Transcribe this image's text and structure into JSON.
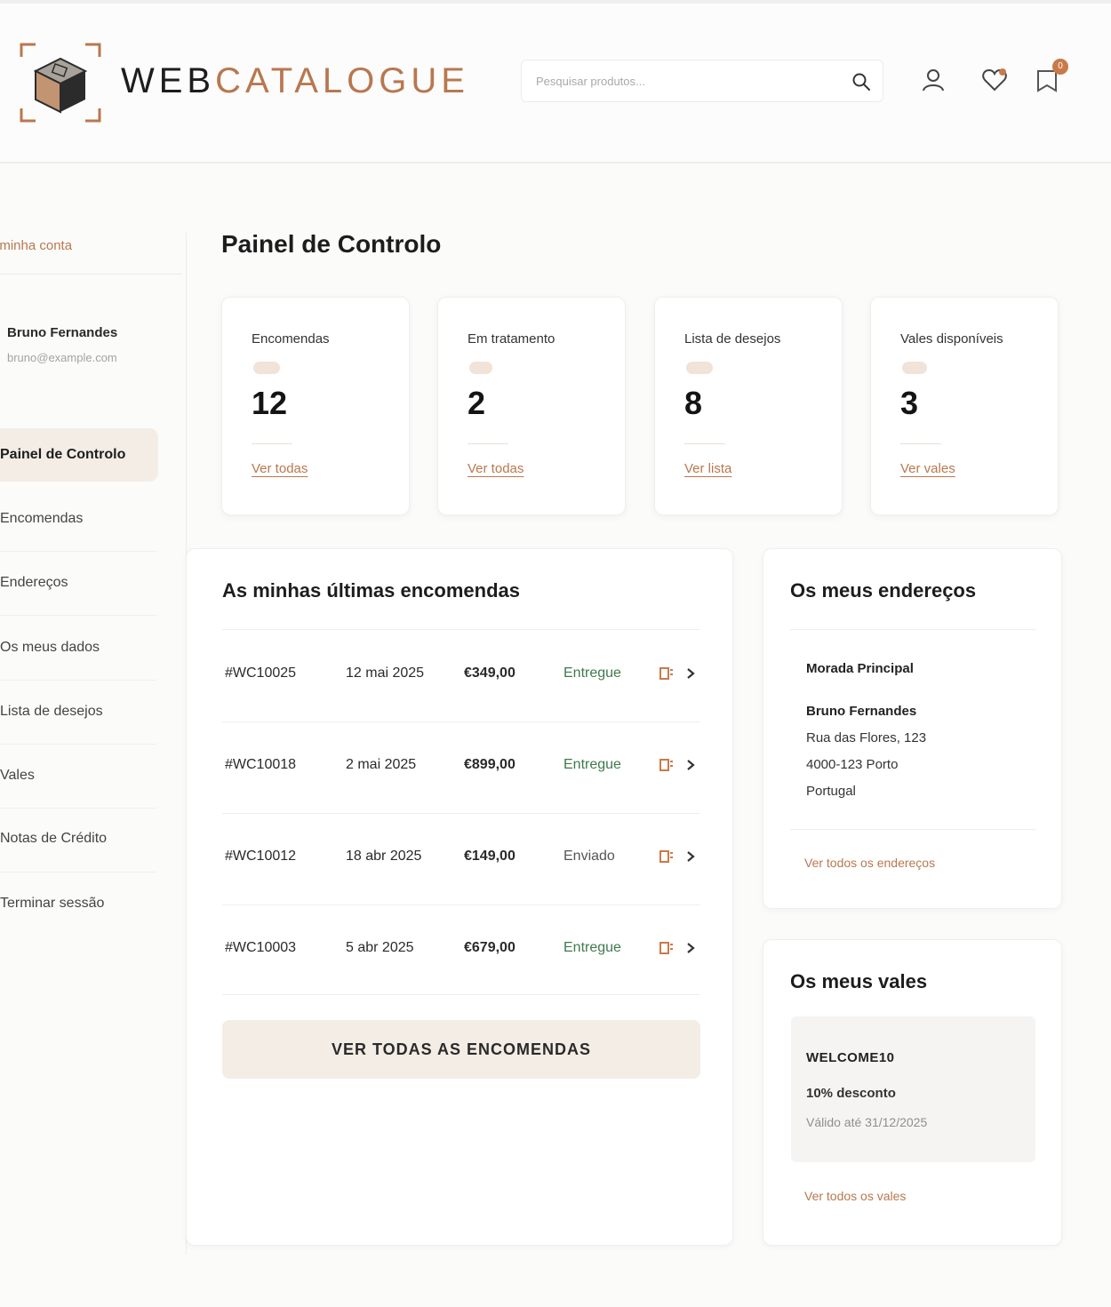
{
  "brand": {
    "part1": "WEB",
    "part2": "CATALOGUE",
    "accent": "#b8784f"
  },
  "search": {
    "placeholder": "Pesquisar produtos..."
  },
  "header_icons": [
    "user-icon",
    "heart-icon",
    "cart-icon"
  ],
  "cart": {
    "count": "0"
  },
  "sidebar": {
    "title": "A minha conta",
    "user_name": "Bruno Fernandes",
    "user_email": "bruno@example.com",
    "items": [
      {
        "label": "Painel de Controlo",
        "active": true
      },
      {
        "label": "Encomendas"
      },
      {
        "label": "Endereços"
      },
      {
        "label": "Os meus dados"
      },
      {
        "label": "Lista de desejos"
      },
      {
        "label": "Vales"
      },
      {
        "label": "Notas de Crédito"
      },
      {
        "label": "Terminar sessão"
      }
    ]
  },
  "main": {
    "title": "Painel de Controlo",
    "stats": [
      {
        "label": "Encomendas",
        "value": "12",
        "link": "Ver todas"
      },
      {
        "label": "Em tratamento",
        "value": "2",
        "link": "Ver todas"
      },
      {
        "label": "Lista de desejos",
        "value": "8",
        "link": "Ver lista"
      },
      {
        "label": "Vales disponíveis",
        "value": "3",
        "link": "Ver vales"
      }
    ]
  },
  "orders": {
    "title": "As minhas últimas encomendas",
    "rows": [
      {
        "id": "#WC10025",
        "date": "12 mai 2025",
        "total": "€349,00",
        "status": "Entregue"
      },
      {
        "id": "#WC10018",
        "date": "2 mai 2025",
        "total": "€899,00",
        "status": "Entregue"
      },
      {
        "id": "#WC10012",
        "date": "18 abr 2025",
        "total": "€149,00",
        "status": "Enviado"
      },
      {
        "id": "#WC10003",
        "date": "5 abr 2025",
        "total": "€679,00",
        "status": "Entregue"
      }
    ],
    "view_all": "VER TODAS AS ENCOMENDAS"
  },
  "addresses": {
    "title": "Os meus endereços",
    "label": "Morada Principal",
    "name": "Bruno Fernandes",
    "line1": "Rua das Flores, 123",
    "line2": "4000-123 Porto",
    "country": "Portugal",
    "link": "Ver todos os endereços"
  },
  "vouchers": {
    "title": "Os meus vales",
    "code": "WELCOME10",
    "discount": "10% desconto",
    "valid": "Válido até 31/12/2025",
    "link": "Ver todos os vales"
  },
  "colors": {
    "accent": "#b8784f",
    "delivered": "#3e7a4c",
    "active_bg": "#f3ede6"
  }
}
